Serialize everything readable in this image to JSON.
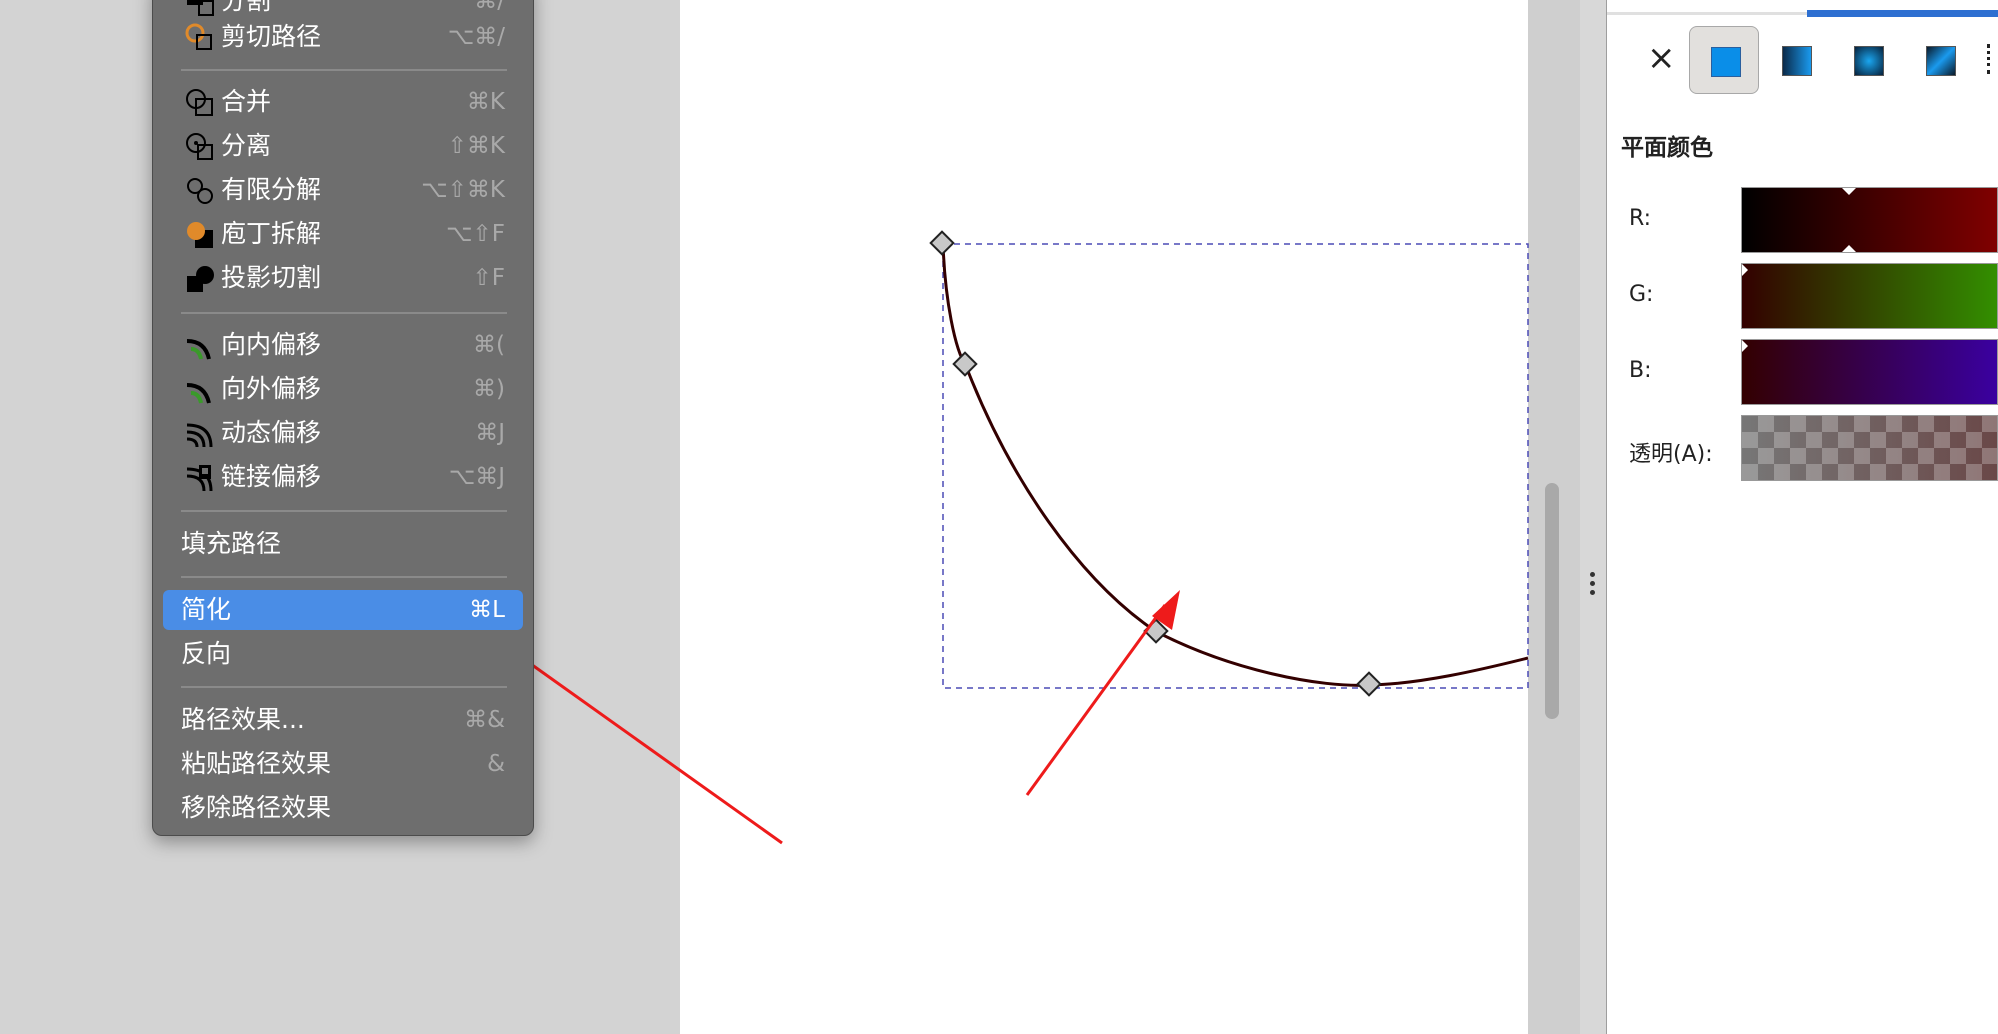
{
  "menu": {
    "partial_items": [
      {
        "label": "分割",
        "shortcut": "⌘/"
      }
    ],
    "items": [
      {
        "label": "剪切路径",
        "shortcut": "⌥⌘/"
      },
      {
        "label": "合并",
        "shortcut": "⌘K"
      },
      {
        "label": "分离",
        "shortcut": "⇧⌘K"
      },
      {
        "label": "有限分解",
        "shortcut": "⌥⇧⌘K"
      },
      {
        "label": "庖丁拆解",
        "shortcut": "⌥⇧F"
      },
      {
        "label": "投影切割",
        "shortcut": "⇧F"
      },
      {
        "label": "向内偏移",
        "shortcut": "⌘("
      },
      {
        "label": "向外偏移",
        "shortcut": "⌘)"
      },
      {
        "label": "动态偏移",
        "shortcut": "⌘J"
      },
      {
        "label": "链接偏移",
        "shortcut": "⌥⌘J"
      },
      {
        "label": "填充路径",
        "shortcut": ""
      },
      {
        "label": "简化",
        "shortcut": "⌘L"
      },
      {
        "label": "反向",
        "shortcut": ""
      },
      {
        "label": "路径效果...",
        "shortcut": "⌘&"
      },
      {
        "label": "粘贴路径效果",
        "shortcut": "&"
      },
      {
        "label": "移除路径效果",
        "shortcut": ""
      }
    ],
    "highlighted": "简化"
  },
  "panel": {
    "close_icon": "×",
    "fill_types": [
      "flat-color",
      "linear-gradient",
      "radial-gradient",
      "mesh-gradient",
      "pattern"
    ],
    "title": "平面颜色",
    "channels": [
      {
        "label": "R:",
        "from": "#000000",
        "to": "#800000"
      },
      {
        "label": "G:",
        "from": "#330000",
        "to": "#338f00"
      },
      {
        "label": "B:",
        "from": "#330000",
        "to": "#3a00a0"
      },
      {
        "label": "透明(A):",
        "from": "#330000",
        "to": "#330000"
      }
    ]
  },
  "colors": {
    "menu_bg": "#6e6e6e",
    "menu_highlight": "#4a8de6",
    "path_stroke": "#330000",
    "selection_dash": "#4b4bb6",
    "arrow": "#ee1b1b",
    "panel_accent": "#2d6fd1"
  }
}
